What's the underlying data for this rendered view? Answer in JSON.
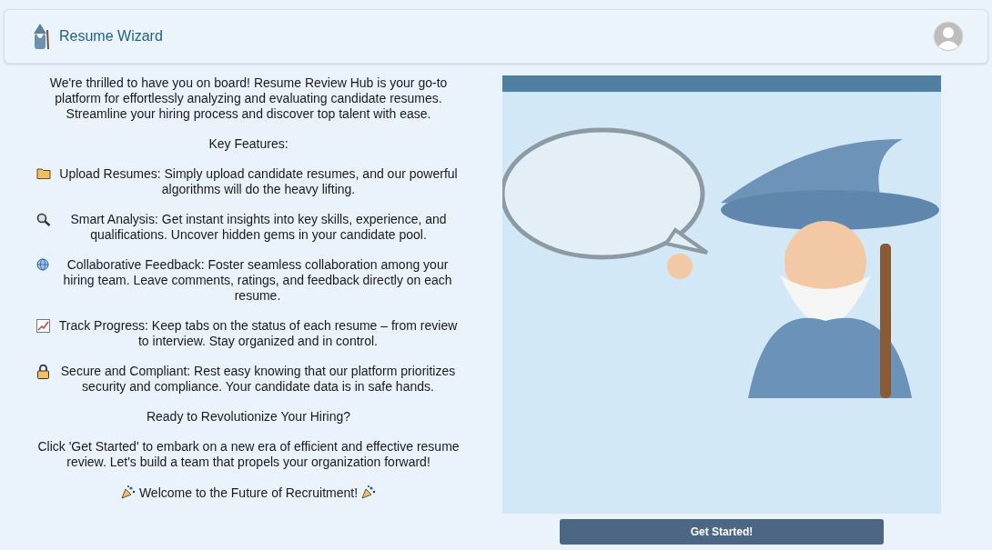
{
  "header": {
    "title": "Resume Wizard"
  },
  "intro": [
    {
      "kind": "text",
      "text": "We're thrilled to have you on board! Resume Review Hub is your go-to platform for effortlessly analyzing and evaluating candidate resumes. Streamline your hiring process and discover top talent with ease."
    },
    {
      "kind": "text",
      "text": "Key Features:"
    },
    {
      "kind": "feature",
      "text": "Upload Resumes: Simply upload candidate resumes, and our powerful algorithms will do the heavy lifting."
    },
    {
      "kind": "feature",
      "text": "Smart Analysis: Get instant insights into key skills, experience, and qualifications. Uncover hidden gems in your candidate pool."
    },
    {
      "kind": "feature",
      "text": "Collaborative Feedback: Foster seamless collaboration among your hiring team. Leave comments, ratings, and feedback directly on each resume."
    },
    {
      "kind": "feature",
      "text": "Track Progress: Keep tabs on the status of each resume – from review to interview. Stay organized and in control."
    },
    {
      "kind": "feature",
      "text": "Secure and Compliant: Rest easy knowing that our platform prioritizes security and compliance. Your candidate data is in safe hands."
    },
    {
      "kind": "text",
      "text": "Ready to Revolutionize Your Hiring?"
    },
    {
      "kind": "text",
      "text": "Click 'Get Started' to embark on a new era of efficient and effective resume review. Let's build a team that propels your organization forward!"
    },
    {
      "kind": "closing",
      "text": "Welcome to the Future of Recruitment!"
    }
  ],
  "button": {
    "label": "Get Started!"
  }
}
